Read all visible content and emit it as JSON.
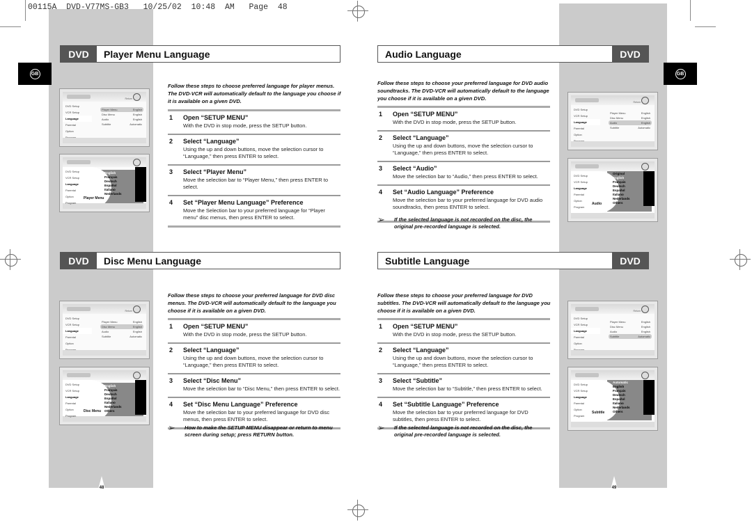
{
  "slug": "00115A  DVD-V77MS-GB3   10/25/02  10:48  AM   Page  48",
  "region_tab": "GB",
  "dvd_badge": "DVD",
  "note_arrow": "➢",
  "sections": {
    "player_menu": {
      "title": "Player Menu Language",
      "intro": "Follow these steps to choose preferred language for player menus. The DVD-VCR will automatically default to the language you choose if it is available on a given DVD.",
      "steps": [
        {
          "num": "1",
          "head": "Open “SETUP MENU”",
          "desc": "With the DVD in stop mode, press the SETUP button."
        },
        {
          "num": "2",
          "head": "Select “Language”",
          "desc": "Using the up and down buttons, move the selection cursor to “Language,” then press ENTER to select."
        },
        {
          "num": "3",
          "head": "Select “Player Menu”",
          "desc": "Move the selection bar to “Player Menu,” then press ENTER to select."
        },
        {
          "num": "4",
          "head": "Set “Player Menu Language” Preference",
          "desc": "Move the Selection bar to your preferred language for “Player menu” disc menus, then press ENTER to select."
        }
      ],
      "screen_label": "Player Menu",
      "languages": [
        "English",
        "Français",
        "Deutsch",
        "Español",
        "Italiano",
        "Nederlands"
      ],
      "selected_option": "Player Menu"
    },
    "audio": {
      "title": "Audio Language",
      "intro": "Follow these steps to choose your preferred language for DVD audio soundtracks. The DVD-VCR will automatically default to the language you choose if it is available on a given DVD.",
      "steps": [
        {
          "num": "1",
          "head": "Open “SETUP MENU”",
          "desc": "With the DVD in stop mode, press the SETUP button."
        },
        {
          "num": "2",
          "head": "Select “Language”",
          "desc": "Using the up and down buttons, move the selection cursor to “Language,” then press ENTER to select."
        },
        {
          "num": "3",
          "head": "Select “Audio”",
          "desc": "Move the selection bar to “Audio,” then press ENTER to select."
        },
        {
          "num": "4",
          "head": "Set “Audio Language” Preference",
          "desc": "Move the selection bar to your preferred language for DVD audio soundtracks, then press ENTER to select."
        }
      ],
      "note": "If the selected language is not recorded on the disc, the original pre-recorded language is selected.",
      "screen_label": "Audio",
      "languages": [
        "Original",
        "English",
        "Français",
        "Deutsch",
        "Español",
        "Italiano",
        "Nederlands",
        "Others"
      ],
      "selected_option": "Audio"
    },
    "disc_menu": {
      "title": "Disc Menu Language",
      "intro": "Follow these steps to choose your preferred language for DVD disc menus. The DVD-VCR will automatically default to the language you choose if it is available on a given DVD.",
      "steps": [
        {
          "num": "1",
          "head": "Open “SETUP MENU”",
          "desc": "With the DVD in stop mode, press the SETUP button."
        },
        {
          "num": "2",
          "head": "Select “Language”",
          "desc": "Using the up and down buttons, move the selection cursor to “Language,” then press ENTER to select."
        },
        {
          "num": "3",
          "head": "Select “Disc Menu”",
          "desc": "Move the selection bar to “Disc Menu,” then press ENTER to select."
        },
        {
          "num": "4",
          "head": "Set “Disc Menu Language” Preference",
          "desc": "Move the selection bar to your preferred language for DVD disc menus, then press ENTER to select."
        }
      ],
      "note": "How to make the SETUP MENU disappear or return to menu screen during setup; press RETURN button.",
      "screen_label": "Disc Menu",
      "languages": [
        "English",
        "Français",
        "Deutsch",
        "Español",
        "Italiano",
        "Nederlands",
        "Others"
      ],
      "selected_option": "Disc Menu"
    },
    "subtitle": {
      "title": "Subtitle Language",
      "intro": "Follow these steps to choose your preferred language for DVD subtitles. The DVD-VCR will automatically default to the language you choose if it is available on a given DVD.",
      "steps": [
        {
          "num": "1",
          "head": "Open “SETUP MENU”",
          "desc": "With the DVD in stop mode, press the SETUP button."
        },
        {
          "num": "2",
          "head": "Select “Language”",
          "desc": "Using the up and down buttons, move the selection cursor to “Language,” then press ENTER to select."
        },
        {
          "num": "3",
          "head": "Select “Subtitle”",
          "desc": "Move the selection bar to “Subtitle,” then press ENTER to select."
        },
        {
          "num": "4",
          "head": "Set “Subtitle Language” Preference",
          "desc": "Move the selection bar to your preferred language for DVD subtitles, then press ENTER to select."
        }
      ],
      "note": "If the selected language is not recorded on the disc, the original pre-recorded language is selected.",
      "screen_label": "Subtitle",
      "languages": [
        "Automatic",
        "English",
        "Français",
        "Deutsch",
        "Español",
        "Italiano",
        "Nederlands",
        "Others"
      ],
      "selected_option": "Subtitle"
    }
  },
  "setup_screen": {
    "return_label": "Return",
    "enter_label": "Enter",
    "sidebar": [
      "DVD Setup",
      "VCR Setup",
      "Language",
      "Parental",
      "Option",
      "Program"
    ],
    "options": [
      {
        "label": "Player Menu",
        "value": "English"
      },
      {
        "label": "Disc Menu",
        "value": "English"
      },
      {
        "label": "Audio",
        "value": "English"
      },
      {
        "label": "Subtitle",
        "value": "Automatic"
      }
    ]
  },
  "page_numbers": {
    "left": "48",
    "right": "49"
  }
}
